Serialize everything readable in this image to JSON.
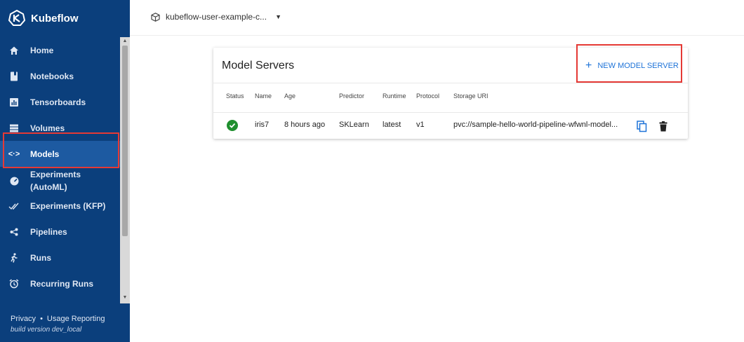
{
  "app": {
    "brand": "Kubeflow"
  },
  "sidebar": {
    "items": [
      {
        "label": "Home",
        "icon": "home-icon"
      },
      {
        "label": "Notebooks",
        "icon": "notebook-icon"
      },
      {
        "label": "Tensorboards",
        "icon": "chart-icon"
      },
      {
        "label": "Volumes",
        "icon": "storage-icon"
      },
      {
        "label": "Models",
        "icon": "code-arrows-icon",
        "active": true
      },
      {
        "label": "Experiments\n(AutoML)",
        "icon": "speedometer-icon"
      },
      {
        "label": "Experiments (KFP)",
        "icon": "double-check-icon"
      },
      {
        "label": "Pipelines",
        "icon": "pipeline-icon"
      },
      {
        "label": "Runs",
        "icon": "runner-icon"
      },
      {
        "label": "Recurring Runs",
        "icon": "alarm-clock-icon"
      }
    ],
    "footer": {
      "privacy": "Privacy",
      "separator": "•",
      "usage": "Usage Reporting",
      "build": "build version dev_local"
    }
  },
  "topbar": {
    "namespace": "kubeflow-user-example-c..."
  },
  "card": {
    "title": "Model Servers",
    "new_button": "NEW MODEL SERVER",
    "columns": [
      "Status",
      "Name",
      "Age",
      "Predictor",
      "Runtime",
      "Protocol",
      "Storage URI"
    ],
    "rows": [
      {
        "status": "ready",
        "name": "iris7",
        "age": "8 hours ago",
        "predictor": "SKLearn",
        "runtime": "latest",
        "protocol": "v1",
        "storage_uri": "pvc://sample-hello-world-pipeline-wfwnl-model..."
      }
    ]
  },
  "colors": {
    "sidebar_bg": "#0b3f7c",
    "active_bg": "#1d5aa1",
    "accent": "#1e73d8",
    "success": "#1f8f2e",
    "highlight": "#e53935"
  }
}
